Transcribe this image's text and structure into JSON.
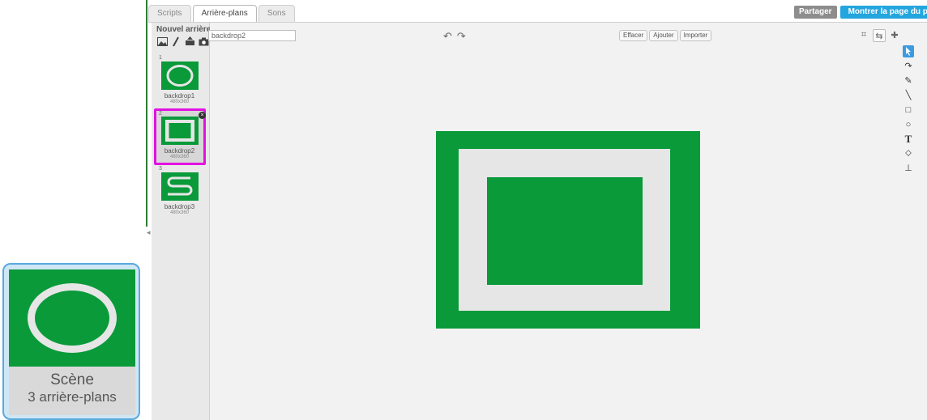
{
  "stage": {
    "name": "Scène",
    "count_label": "3 arrière-plans"
  },
  "tabs": [
    {
      "label": "Scripts",
      "active": false
    },
    {
      "label": "Arrière-plans",
      "active": true
    },
    {
      "label": "Sons",
      "active": false
    }
  ],
  "header": {
    "share_label": "Partager",
    "view_project_label": "Montrer la page du projet"
  },
  "backdrop_panel": {
    "new_label": "Nouvel arrière-plan:",
    "new_tools": [
      "image-library-icon",
      "paint-brush-icon",
      "upload-icon",
      "camera-icon"
    ]
  },
  "backdrops": [
    {
      "number": "1",
      "name": "backdrop1",
      "size": "480x360"
    },
    {
      "number": "2",
      "name": "backdrop2",
      "size": "480x360",
      "selected": true
    },
    {
      "number": "3",
      "name": "backdrop3",
      "size": "480x360"
    }
  ],
  "editor": {
    "name_value": "backdrop2",
    "buttons": {
      "clear": "Effacer",
      "add": "Ajouter",
      "import": "Importer"
    }
  },
  "colors": {
    "green": "#0a9a3a",
    "light_gray": "#e6e6e6",
    "accent_blue": "#23a5de",
    "selection_magenta": "#e112e1"
  },
  "tools": [
    "select-arrow-icon",
    "reshape-icon",
    "pencil-icon",
    "line-icon",
    "rectangle-icon",
    "ellipse-icon",
    "text-icon",
    "fill-bucket-icon",
    "stamp-icon"
  ]
}
